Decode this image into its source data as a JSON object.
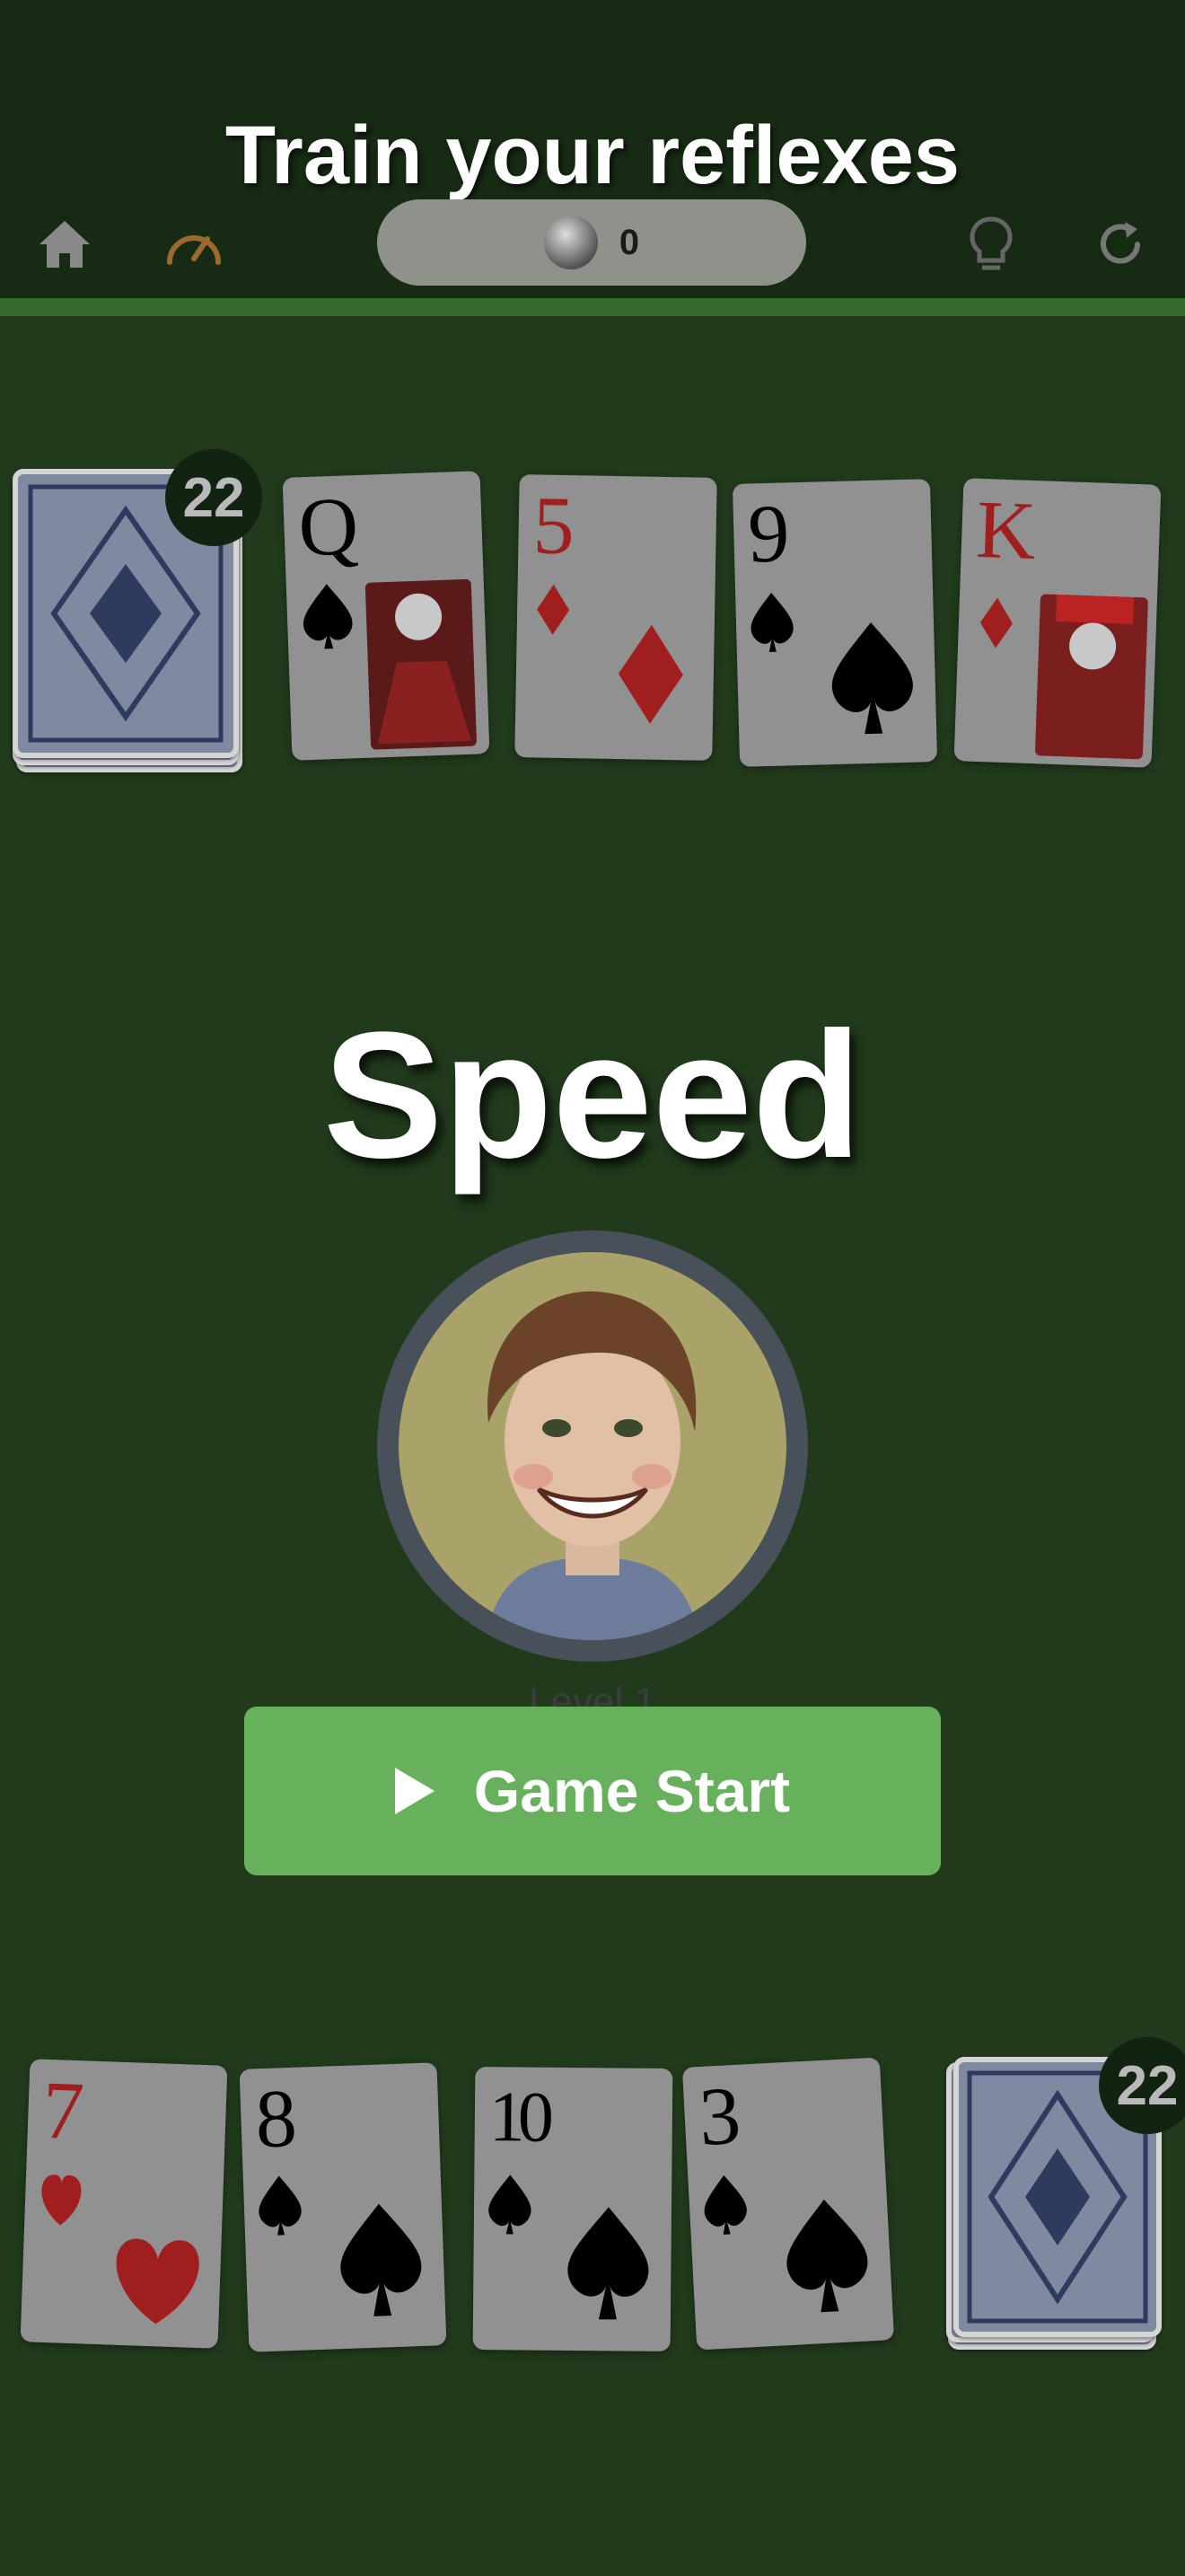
{
  "header": {
    "title": "Train your reflexes",
    "coins": "0",
    "icons": [
      "home-icon",
      "speedometer-icon",
      "lightbulb-icon",
      "refresh-icon"
    ]
  },
  "opponent": {
    "deck_count": "22",
    "cards": [
      {
        "rank": "Q",
        "suit": "spade",
        "color": "black"
      },
      {
        "rank": "5",
        "suit": "diamond",
        "color": "red"
      },
      {
        "rank": "9",
        "suit": "spade",
        "color": "black"
      },
      {
        "rank": "K",
        "suit": "diamond",
        "color": "red"
      }
    ]
  },
  "game": {
    "title": "Speed",
    "level_label": "Level 1",
    "start_label": "Game Start"
  },
  "player": {
    "deck_count": "22",
    "cards": [
      {
        "rank": "7",
        "suit": "heart",
        "color": "red"
      },
      {
        "rank": "8",
        "suit": "spade",
        "color": "black"
      },
      {
        "rank": "10",
        "suit": "spade",
        "color": "black"
      },
      {
        "rank": "3",
        "suit": "spade",
        "color": "black"
      }
    ]
  },
  "colors": {
    "table": "#213a1c",
    "topbar": "#172b14",
    "button": "#68b15c",
    "red_suit": "#a01e1e"
  }
}
